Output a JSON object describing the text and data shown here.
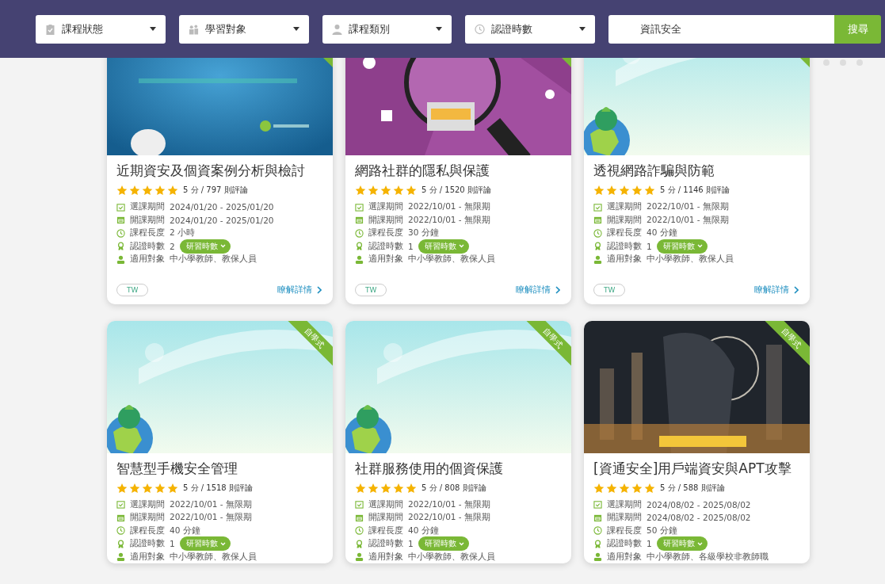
{
  "filters": [
    {
      "kind": "status",
      "label": "課程狀態"
    },
    {
      "kind": "audience",
      "label": "學習對象"
    },
    {
      "kind": "category",
      "label": "課程類別"
    },
    {
      "kind": "hours",
      "label": "認證時數"
    }
  ],
  "search": {
    "value": "資訊安全",
    "button": "搜尋"
  },
  "courses": [
    {
      "thumbnail": {
        "kind": "picture"
      },
      "title": "近期資安及個資案例分析與檢討",
      "stars": 5,
      "rating": "5 分 / 797 則評論",
      "info": [
        {
          "kind": "select",
          "label": "選課期間",
          "value": "2024/01/20 - 2025/01/20"
        },
        {
          "kind": "open",
          "label": "開課期間",
          "value": "2024/01/20 - 2025/01/20"
        },
        {
          "kind": "length",
          "label": "課程長度",
          "value": "2 小時"
        },
        {
          "kind": "credit",
          "label": "認證時數",
          "value": "2",
          "badge": "研習時數"
        },
        {
          "kind": "audience",
          "label": "適用對象",
          "value": "中小學教師、教保人員"
        }
      ],
      "tag": "TW",
      "link": "瞭解詳情"
    },
    {
      "thumbnail": {
        "kind": "picture"
      },
      "title": "網路社群的隱私與保護",
      "stars": 5,
      "rating": "5 分 / 1520 則評論",
      "info": [
        {
          "kind": "select",
          "label": "選課期間",
          "value": "2022/10/01 - 無限期"
        },
        {
          "kind": "open",
          "label": "開課期間",
          "value": "2022/10/01 - 無限期"
        },
        {
          "kind": "length",
          "label": "課程長度",
          "value": "30 分鐘"
        },
        {
          "kind": "credit",
          "label": "認證時數",
          "value": "1",
          "badge": "研習時數"
        },
        {
          "kind": "audience",
          "label": "適用對象",
          "value": "中小學教師、教保人員"
        }
      ],
      "tag": "TW",
      "link": "瞭解詳情"
    },
    {
      "thumbnail": {
        "kind": "picture"
      },
      "title": "透視網路詐騙與防範",
      "stars": 5,
      "rating": "5 分 / 1146 則評論",
      "info": [
        {
          "kind": "select",
          "label": "選課期間",
          "value": "2022/10/01 - 無限期"
        },
        {
          "kind": "open",
          "label": "開課期間",
          "value": "2022/10/01 - 無限期"
        },
        {
          "kind": "length",
          "label": "課程長度",
          "value": "40 分鐘"
        },
        {
          "kind": "credit",
          "label": "認證時數",
          "value": "1",
          "badge": "研習時數"
        },
        {
          "kind": "audience",
          "label": "適用對象",
          "value": "中小學教師、教保人員"
        }
      ],
      "tag": "TW",
      "link": "瞭解詳情"
    },
    {
      "thumbnail": {
        "kind": "picture"
      },
      "ribbon": "自學式",
      "title": "智慧型手機安全管理",
      "stars": 5,
      "rating": "5 分 / 1518 則評論",
      "info": [
        {
          "kind": "select",
          "label": "選課期間",
          "value": "2022/10/01 - 無限期"
        },
        {
          "kind": "open",
          "label": "開課期間",
          "value": "2022/10/01 - 無限期"
        },
        {
          "kind": "length",
          "label": "課程長度",
          "value": "40 分鐘"
        },
        {
          "kind": "credit",
          "label": "認證時數",
          "value": "1",
          "badge": "研習時數"
        },
        {
          "kind": "audience",
          "label": "適用對象",
          "value": "中小學教師、教保人員"
        }
      ]
    },
    {
      "thumbnail": {
        "kind": "picture"
      },
      "ribbon": "自學式",
      "title": "社群服務使用的個資保護",
      "stars": 5,
      "rating": "5 分 / 808 則評論",
      "info": [
        {
          "kind": "select",
          "label": "選課期間",
          "value": "2022/10/01 - 無限期"
        },
        {
          "kind": "open",
          "label": "開課期間",
          "value": "2022/10/01 - 無限期"
        },
        {
          "kind": "length",
          "label": "課程長度",
          "value": "40 分鐘"
        },
        {
          "kind": "credit",
          "label": "認證時數",
          "value": "1",
          "badge": "研習時數"
        },
        {
          "kind": "audience",
          "label": "適用對象",
          "value": "中小學教師、教保人員"
        }
      ]
    },
    {
      "thumbnail": {
        "kind": "picture"
      },
      "ribbon": "自學式",
      "title": "[資通安全]用戶端資安與APT攻擊",
      "stars": 5,
      "rating": "5 分 / 588 則評論",
      "info": [
        {
          "kind": "select",
          "label": "選課期間",
          "value": "2024/08/02 - 2025/08/02"
        },
        {
          "kind": "open",
          "label": "開課期間",
          "value": "2024/08/02 - 2025/08/02"
        },
        {
          "kind": "length",
          "label": "課程長度",
          "value": "50 分鐘"
        },
        {
          "kind": "credit",
          "label": "認證時數",
          "value": "1",
          "badge": "研習時數"
        },
        {
          "kind": "audience",
          "label": "適用對象",
          "value": "中小學教師、各級學校非教師職"
        }
      ]
    }
  ]
}
